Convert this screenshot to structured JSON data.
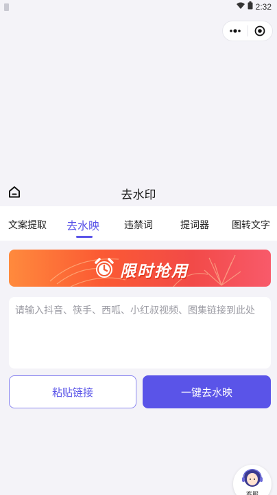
{
  "status_bar": {
    "time": "2:32"
  },
  "nav": {
    "title": "去水印"
  },
  "tabs": [
    {
      "label": "文案提取"
    },
    {
      "label": "去水映"
    },
    {
      "label": "违禁词"
    },
    {
      "label": "提词器"
    },
    {
      "label": "图转文字"
    }
  ],
  "banner": {
    "text": "限时抢用"
  },
  "input": {
    "value": "",
    "placeholder": "请输入抖音、筷手、西呱、小红叔视频、图集链接到此处"
  },
  "buttons": {
    "paste": "粘贴链接",
    "remove": "一键去水映"
  },
  "service": {
    "label": "客服"
  },
  "colors": {
    "accent": "#5a54e8",
    "banner_start": "#ff8a3d",
    "banner_end": "#f85a6a"
  }
}
